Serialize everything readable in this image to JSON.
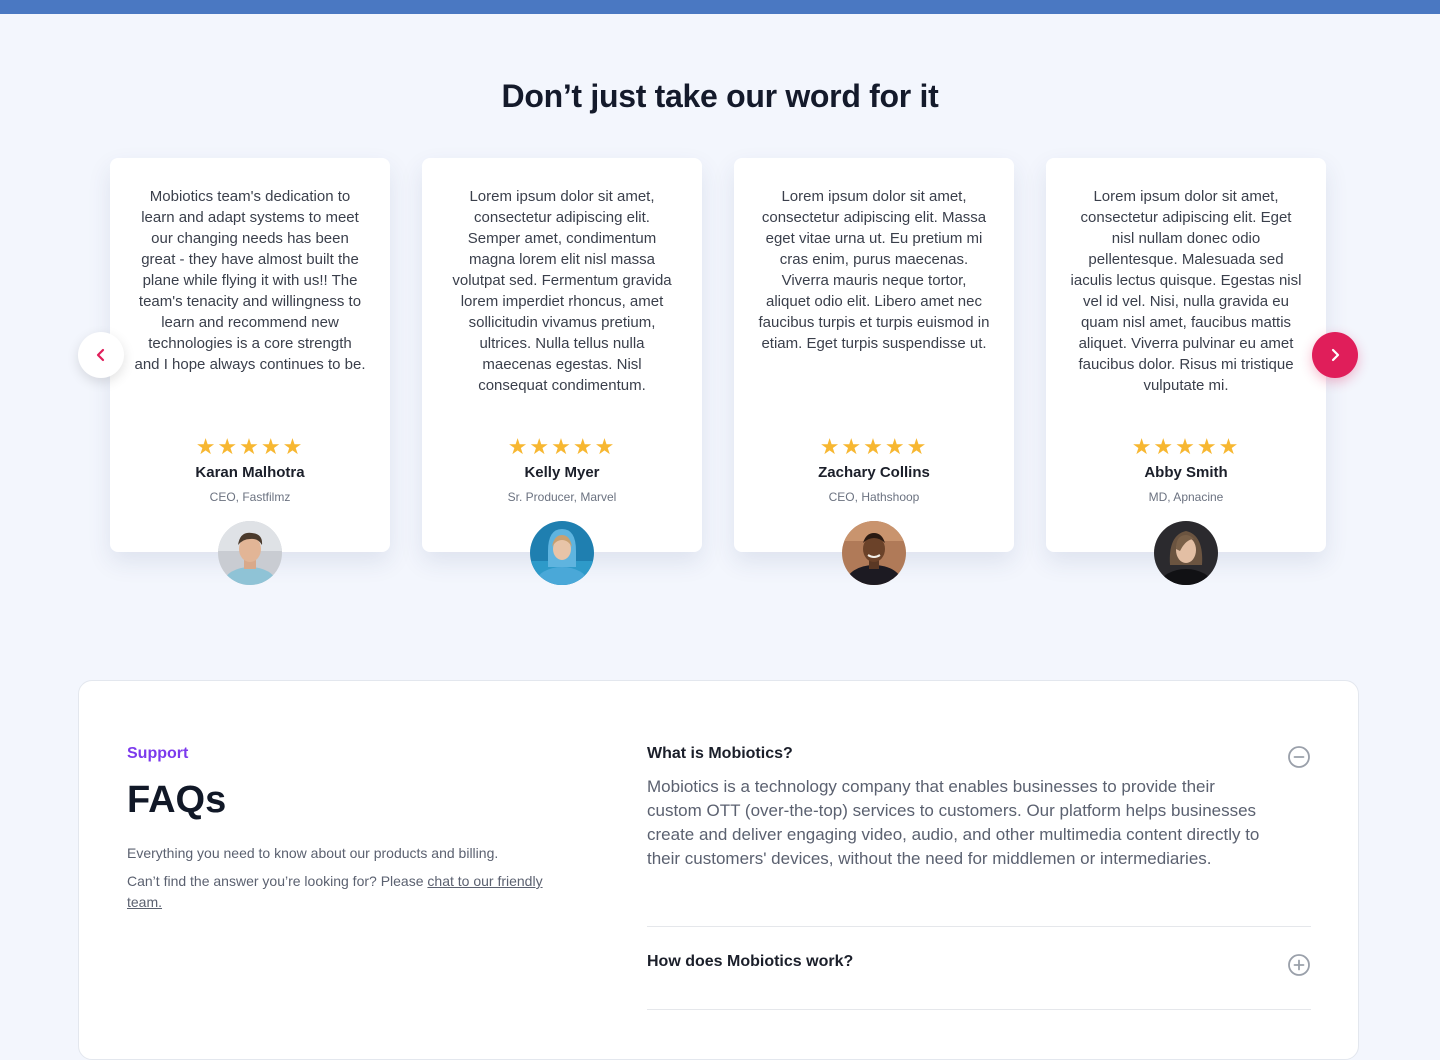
{
  "section": {
    "title": "Don’t just take our word for it"
  },
  "testimonials": [
    {
      "quote": "Mobiotics team's dedication to learn and adapt systems to meet our changing needs has been great - they have almost built the plane while flying it with us!! The team's tenacity and willingness to learn and recommend new technologies is a core strength and I hope always continues to be.",
      "stars": "★★★★★",
      "rating": 5,
      "name": "Karan Malhotra",
      "role": "CEO, Fastfilmz"
    },
    {
      "quote": "Lorem ipsum dolor sit amet, consectetur adipiscing elit. Semper amet, condimentum magna lorem elit nisl massa volutpat sed. Fermentum gravida lorem imperdiet rhoncus, amet sollicitudin vivamus pretium, ultrices. Nulla tellus nulla maecenas egestas. Nisl consequat condimentum.",
      "stars": "★★★★★",
      "rating": 5,
      "name": "Kelly Myer",
      "role": "Sr. Producer, Marvel"
    },
    {
      "quote": "Lorem ipsum dolor sit amet, consectetur adipiscing elit. Massa eget vitae urna ut. Eu pretium mi cras enim, purus maecenas. Viverra mauris neque tortor, aliquet odio elit. Libero amet nec faucibus turpis et turpis euismod in etiam. Eget turpis suspendisse ut.",
      "stars": "★★★★★",
      "rating": 5,
      "name": "Zachary Collins",
      "role": "CEO, Hathshoop"
    },
    {
      "quote": "Lorem ipsum dolor sit amet, consectetur adipiscing elit. Eget nisl nullam donec odio pellentesque. Malesuada sed iaculis lectus quisque. Egestas nisl vel id vel. Nisi, nulla gravida eu quam nisl amet, faucibus mattis aliquet. Viverra pulvinar eu amet faucibus dolor. Risus mi tristique vulputate mi.",
      "stars": "★★★★★",
      "rating": 5,
      "name": "Abby Smith",
      "role": "MD, Apnacine"
    }
  ],
  "carousel": {
    "prev_icon": "chevron-left-icon",
    "next_icon": "chevron-right-icon"
  },
  "faq": {
    "eyebrow": "Support",
    "heading": "FAQs",
    "description": "Everything you need to know about our products and billing.",
    "help_prefix": "Can’t find the answer you’re looking for? Please ",
    "help_link": "chat to our friendly team.",
    "items": [
      {
        "question": "What is Mobiotics?",
        "answer": "Mobiotics is a technology company that enables businesses to provide their custom OTT (over-the-top) services to customers. Our platform helps businesses create and deliver engaging video, audio, and other multimedia content directly to their customers' devices, without the need for middlemen or intermediaries.",
        "expanded": true,
        "icon": "minus-circle-icon"
      },
      {
        "question": "How does Mobiotics work?",
        "answer": "",
        "expanded": false,
        "icon": "plus-circle-icon"
      }
    ]
  },
  "colors": {
    "top_bar": "#4a78c2",
    "background": "#f3f6fd",
    "accent": "#e01e5a",
    "star": "#f7b731",
    "eyebrow": "#7c3aed"
  }
}
